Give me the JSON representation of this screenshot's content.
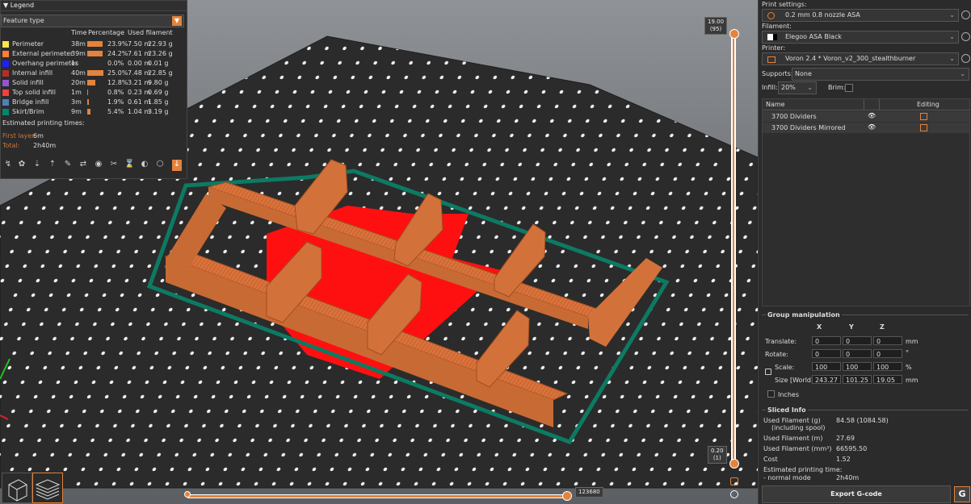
{
  "legend": {
    "title": "Legend",
    "view_type": "Feature type",
    "columns": {
      "time": "Time",
      "percentage": "Percentage",
      "used": "Used filament"
    },
    "rows": [
      {
        "name": "Perimeter",
        "color": "#ffe64d",
        "time": "38m",
        "pct": "23.9%",
        "len": "7.50 m",
        "wt": "22.93 g",
        "frac": 0.239
      },
      {
        "name": "External perimeter",
        "color": "#ff7d38",
        "time": "39m",
        "pct": "24.2%",
        "len": "7.61 m",
        "wt": "23.26 g",
        "frac": 0.242
      },
      {
        "name": "Overhang perimeter",
        "color": "#1f1fff",
        "time": "1s",
        "pct": "0.0%",
        "len": "0.00 m",
        "wt": "0.01 g",
        "frac": 0.0
      },
      {
        "name": "Internal infill",
        "color": "#b03029",
        "time": "40m",
        "pct": "25.0%",
        "len": "7.48 m",
        "wt": "22.85 g",
        "frac": 0.25
      },
      {
        "name": "Solid infill",
        "color": "#9654cc",
        "time": "20m",
        "pct": "12.8%",
        "len": "3.21 m",
        "wt": "9.80 g",
        "frac": 0.128
      },
      {
        "name": "Top solid infill",
        "color": "#f04040",
        "time": "1m",
        "pct": "0.8%",
        "len": "0.23 m",
        "wt": "0.69 g",
        "frac": 0.008
      },
      {
        "name": "Bridge infill",
        "color": "#4d80ba",
        "time": "3m",
        "pct": "1.9%",
        "len": "0.61 m",
        "wt": "1.85 g",
        "frac": 0.019
      },
      {
        "name": "Skirt/Brim",
        "color": "#00876e",
        "time": "9m",
        "pct": "5.4%",
        "len": "1.04 m",
        "wt": "3.19 g",
        "frac": 0.054
      }
    ],
    "est_title": "Estimated printing times:",
    "first_layer_label": "First layer:",
    "first_layer": "6m",
    "total_label": "Total:",
    "total": "2h40m"
  },
  "slider": {
    "top_label": "19.00",
    "top_layer": "(95)",
    "bottom_label": "0.20",
    "bottom_layer": "(1)",
    "h_value": "123680"
  },
  "sidebar": {
    "print_settings_label": "Print settings:",
    "print_settings": "0.2 mm 0.8 nozzle ASA",
    "filament_label": "Filament:",
    "filament": "Elegoo ASA Black",
    "printer_label": "Printer:",
    "printer": "Voron 2.4 * Voron_v2_300_stealthburner",
    "supports_label": "Supports:",
    "supports": "None",
    "infill_label": "Infill:",
    "infill": "20%",
    "brim_label": "Brim:",
    "col_name": "Name",
    "col_editing": "Editing",
    "objects": [
      "3700 Dividers",
      "3700 Dividers Mirrored"
    ],
    "group_title": "Group manipulation",
    "axes": [
      "X",
      "Y",
      "Z"
    ],
    "translate_label": "Translate:",
    "translate": [
      "0",
      "0",
      "0"
    ],
    "rotate_label": "Rotate:",
    "rotate": [
      "0",
      "0",
      "0"
    ],
    "scale_label": "Scale:",
    "scale": [
      "100",
      "100",
      "100"
    ],
    "size_label": "Size [World]:",
    "size": [
      "243.27",
      "101.25",
      "19.05"
    ],
    "unit_mm": "mm",
    "unit_deg": "°",
    "unit_pct": "%",
    "inches_label": "Inches",
    "sliced_title": "Sliced Info",
    "used_g_label": "Used Filament (g)",
    "used_g_sub": "(including spool)",
    "used_g": "84.58 (1084.58)",
    "used_m_label": "Used Filament (m)",
    "used_m": "27.69",
    "used_mm3_label": "Used Filament (mm³)",
    "used_mm3": "66595.50",
    "cost_label": "Cost",
    "cost": "1.52",
    "est_label": "Estimated printing time:",
    "mode_label": "- normal mode",
    "mode_time": "2h40m",
    "export_label": "Export G-code"
  },
  "colors": {
    "accent": "#e3833c",
    "panel": "#2b2b2b"
  }
}
